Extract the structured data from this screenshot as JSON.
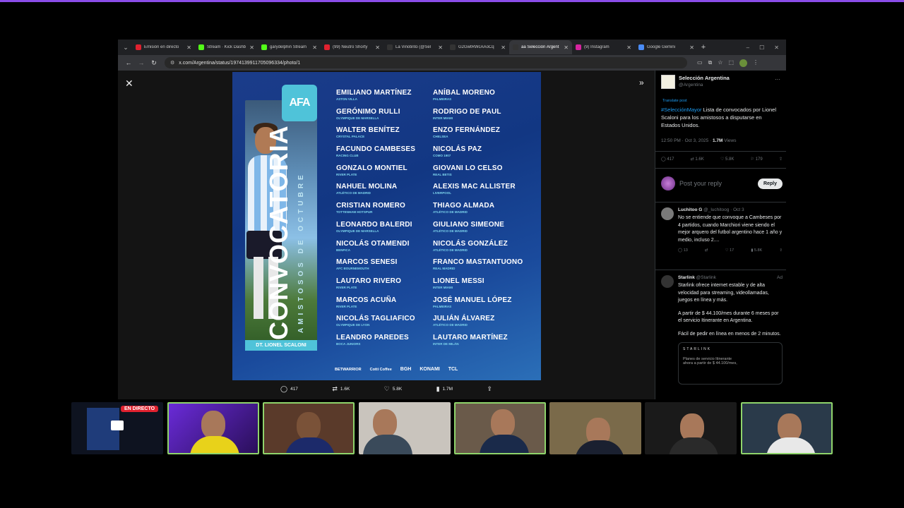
{
  "browser": {
    "tabs": [
      {
        "label": "Emisión en directo",
        "color": "#e0212f",
        "icon": "youtube-icon"
      },
      {
        "label": "Stream · Kick Dashb",
        "color": "#53fc18",
        "icon": "kick-icon"
      },
      {
        "label": "garydelphin Stream",
        "color": "#53fc18",
        "icon": "kick-icon"
      },
      {
        "label": "(99) Neutro Shorty",
        "color": "#e0212f",
        "icon": "youtube-icon"
      },
      {
        "label": "La Vinotinto (@Sel",
        "color": "#333333",
        "icon": "x-icon"
      },
      {
        "label": "G2GwtRWcAAoCq",
        "color": "#333333",
        "icon": "x-icon"
      },
      {
        "label": "aa Selección Argent",
        "color": "#333333",
        "icon": "x-icon",
        "active": true
      },
      {
        "label": "(9) Instagram",
        "color": "#d6249f",
        "icon": "instagram-icon"
      },
      {
        "label": "Google Gemini",
        "color": "#4a8cf7",
        "icon": "gemini-icon"
      }
    ],
    "url": "x.com/Argentina/status/1974139911705096334/photo/1"
  },
  "poster": {
    "crest": "AFA",
    "title": "CONVOCATORIA",
    "subtitle": "AMISTOSOS DE OCTUBRE",
    "coach": "DT. LIONEL SCALONI",
    "col1": [
      {
        "name": "EMILIANO MARTÍNEZ",
        "club": "ASTON VILLA"
      },
      {
        "name": "GERÓNIMO RULLI",
        "club": "OLYMPIQUE DE MARSELLA"
      },
      {
        "name": "WALTER BENÍTEZ",
        "club": "CRYSTAL PALACE"
      },
      {
        "name": "FACUNDO CAMBESES",
        "club": "RACING CLUB"
      },
      {
        "name": "GONZALO MONTIEL",
        "club": "RIVER PLATE"
      },
      {
        "name": "NAHUEL MOLINA",
        "club": "ATLÉTICO DE MADRID"
      },
      {
        "name": "CRISTIAN ROMERO",
        "club": "TOTTENHAM HOTSPUR"
      },
      {
        "name": "LEONARDO BALERDI",
        "club": "OLYMPIQUE DE MARSELLA"
      },
      {
        "name": "NICOLÁS OTAMENDI",
        "club": "BENFICA"
      },
      {
        "name": "MARCOS SENESI",
        "club": "AFC BOURNEMOUTH"
      },
      {
        "name": "LAUTARO RIVERO",
        "club": "RIVER PLATE"
      },
      {
        "name": "MARCOS ACUÑA",
        "club": "RIVER PLATE"
      },
      {
        "name": "NICOLÁS TAGLIAFICO",
        "club": "OLYMPIQUE DE LYON"
      },
      {
        "name": "LEANDRO PAREDES",
        "club": "BOCA JUNIORS"
      }
    ],
    "col2": [
      {
        "name": "ANÍBAL MORENO",
        "club": "PALMEIRAS"
      },
      {
        "name": "RODRIGO DE PAUL",
        "club": "INTER MIAMI"
      },
      {
        "name": "ENZO FERNÁNDEZ",
        "club": "CHELSEA"
      },
      {
        "name": "NICOLÁS PAZ",
        "club": "COMO 1907"
      },
      {
        "name": "GIOVANI LO CELSO",
        "club": "REAL BETIS"
      },
      {
        "name": "ALEXIS MAC ALLISTER",
        "club": "LIVERPOOL"
      },
      {
        "name": "THIAGO ALMADA",
        "club": "ATLÉTICO DE MADRID"
      },
      {
        "name": "GIULIANO SIMEONE",
        "club": "ATLÉTICO DE MADRID"
      },
      {
        "name": "NICOLÁS GONZÁLEZ",
        "club": "ATLÉTICO DE MADRID"
      },
      {
        "name": "FRANCO MASTANTUONO",
        "club": "REAL MADRID"
      },
      {
        "name": "LIONEL MESSI",
        "club": "INTER MIAMI"
      },
      {
        "name": "JOSÉ MANUEL LÓPEZ",
        "club": "PALMEIRAS"
      },
      {
        "name": "JULIÁN ÁLVAREZ",
        "club": "ATLÉTICO DE MADRID"
      },
      {
        "name": "LAUTARO MARTÍNEZ",
        "club": "INTER DE MILÁN"
      }
    ],
    "sponsors": [
      "BETWARRIOR",
      "Cotti Coffee",
      "BGH",
      "KONAMI",
      "TCL"
    ]
  },
  "actions": {
    "replies": "417",
    "reposts": "1.6K",
    "likes": "5.8K",
    "views": "1.7M"
  },
  "post": {
    "author": "Selección Argentina",
    "handle": "@Argentina",
    "translate": "Translate post",
    "hashtag": "#SelecciónMayor",
    "text": " Lista de convocados por Lionel Scaloni para los amistosos a disputarse en Estados Unidos.",
    "time": "12:50 PM · Oct 3, 2025 · ",
    "views_count": "1.7M",
    "views_label": " Views",
    "stats": {
      "replies": "417",
      "reposts": "1.6K",
      "likes": "5.8K",
      "bookmarks": "179"
    },
    "reply_placeholder": "Post your reply",
    "reply_button": "Reply"
  },
  "replies": [
    {
      "name": "Luchitoo G",
      "handle": " @_luchitoog · Oct 3",
      "text": "No se entiende que convoque a Cambeses por 4 partidos, cuando Marchiori viene siendo el mejor arquero del futbol argentino hace 1 año y medio, incluso 2....",
      "stats": {
        "replies": "13",
        "reposts": "",
        "likes": "17",
        "views": "5.8K"
      }
    },
    {
      "name": "Starlink",
      "handle": " @Starlink",
      "ad": "Ad",
      "text": "Starlink ofrece internet estable y de alta velocidad para streaming, videollamadas, juegos en línea y más.",
      "text2": "A partir de $ 44.100/mes durante 6 meses por el servicio Itinerante en Argentina.",
      "text3": "Fácil de pedir en línea en menos de 2 minutos.",
      "card_brand": "STARLINK",
      "card_line1": "Planes de servicio Itinerante",
      "card_line2": "ahora a partir de $ 44.100/mes,"
    }
  ],
  "stream": {
    "live_label": "EN DIRECTO"
  }
}
